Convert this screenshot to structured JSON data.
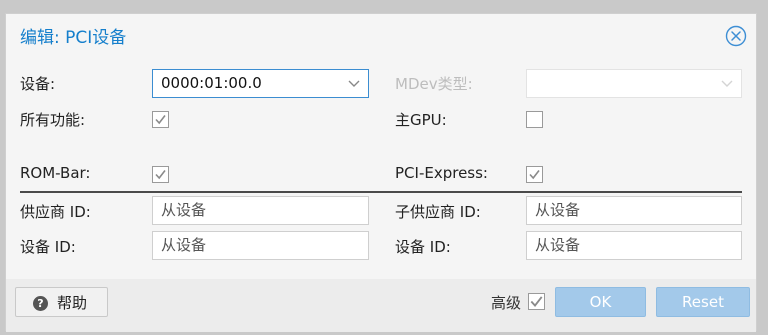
{
  "dialog": {
    "title": "编辑: PCI设备"
  },
  "form": {
    "device_label": "设备:",
    "device_value": "0000:01:00.0",
    "mdev_label": "MDev类型:",
    "mdev_value": "",
    "all_functions_label": "所有功能:",
    "all_functions_checked": true,
    "primary_gpu_label": "主GPU:",
    "primary_gpu_checked": false,
    "rombar_label": "ROM-Bar:",
    "rombar_checked": true,
    "pcie_label": "PCI-Express:",
    "pcie_checked": true,
    "vendor_id_label": "供应商 ID:",
    "vendor_id_placeholder": "从设备",
    "subsystem_vendor_label": "子供应商 ID:",
    "subsystem_vendor_placeholder": "从设备",
    "device_id_label": "设备 ID:",
    "device_id_placeholder": "从设备",
    "subsystem_device_label": "设备 ID:",
    "subsystem_device_placeholder": "从设备"
  },
  "footer": {
    "help_label": "帮助",
    "advanced_label": "高级",
    "advanced_checked": true,
    "ok_label": "OK",
    "reset_label": "Reset"
  },
  "colors": {
    "accent": "#157fcc",
    "button_disabled": "#a3c9ea"
  }
}
